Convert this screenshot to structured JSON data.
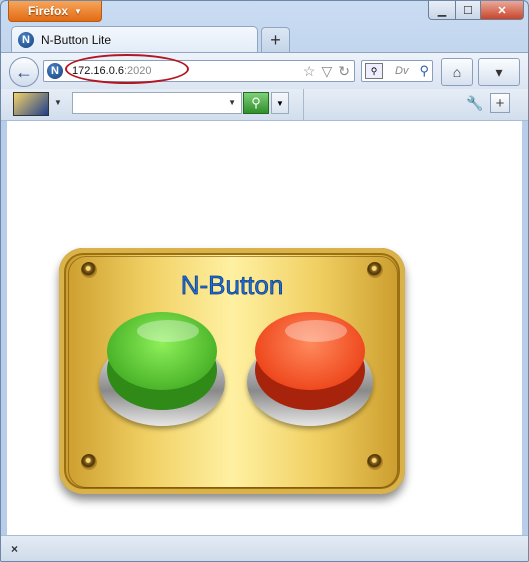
{
  "browser": {
    "menu_label": "Firefox",
    "window_controls": {
      "minimize": "▁",
      "maximize": "☐",
      "close": "✕"
    }
  },
  "tab": {
    "title": "N-Button Lite",
    "favicon": "N",
    "new_tab": "+"
  },
  "navbar": {
    "back": "←",
    "url_host": "172.16.0.6",
    "url_port": ":2020",
    "search_placeholder": "Dv",
    "search_engine_icon": "⚲",
    "search_go": "⚲",
    "bookmark_star": "☆",
    "history_caret": "▽",
    "reload": "↻",
    "home": "⌂",
    "bookmarks_menu": "▾"
  },
  "toolbar": {
    "caret": "▼",
    "combo_caret": "▼",
    "go": "⚲",
    "go_caret": "▼",
    "wrench": "🔧",
    "add": "+"
  },
  "page": {
    "title": "N-Button",
    "buttons": [
      {
        "name": "green",
        "color": "#4cb52a"
      },
      {
        "name": "red",
        "color": "#ef4a1f"
      }
    ]
  },
  "statusbar": {
    "close": "×"
  }
}
